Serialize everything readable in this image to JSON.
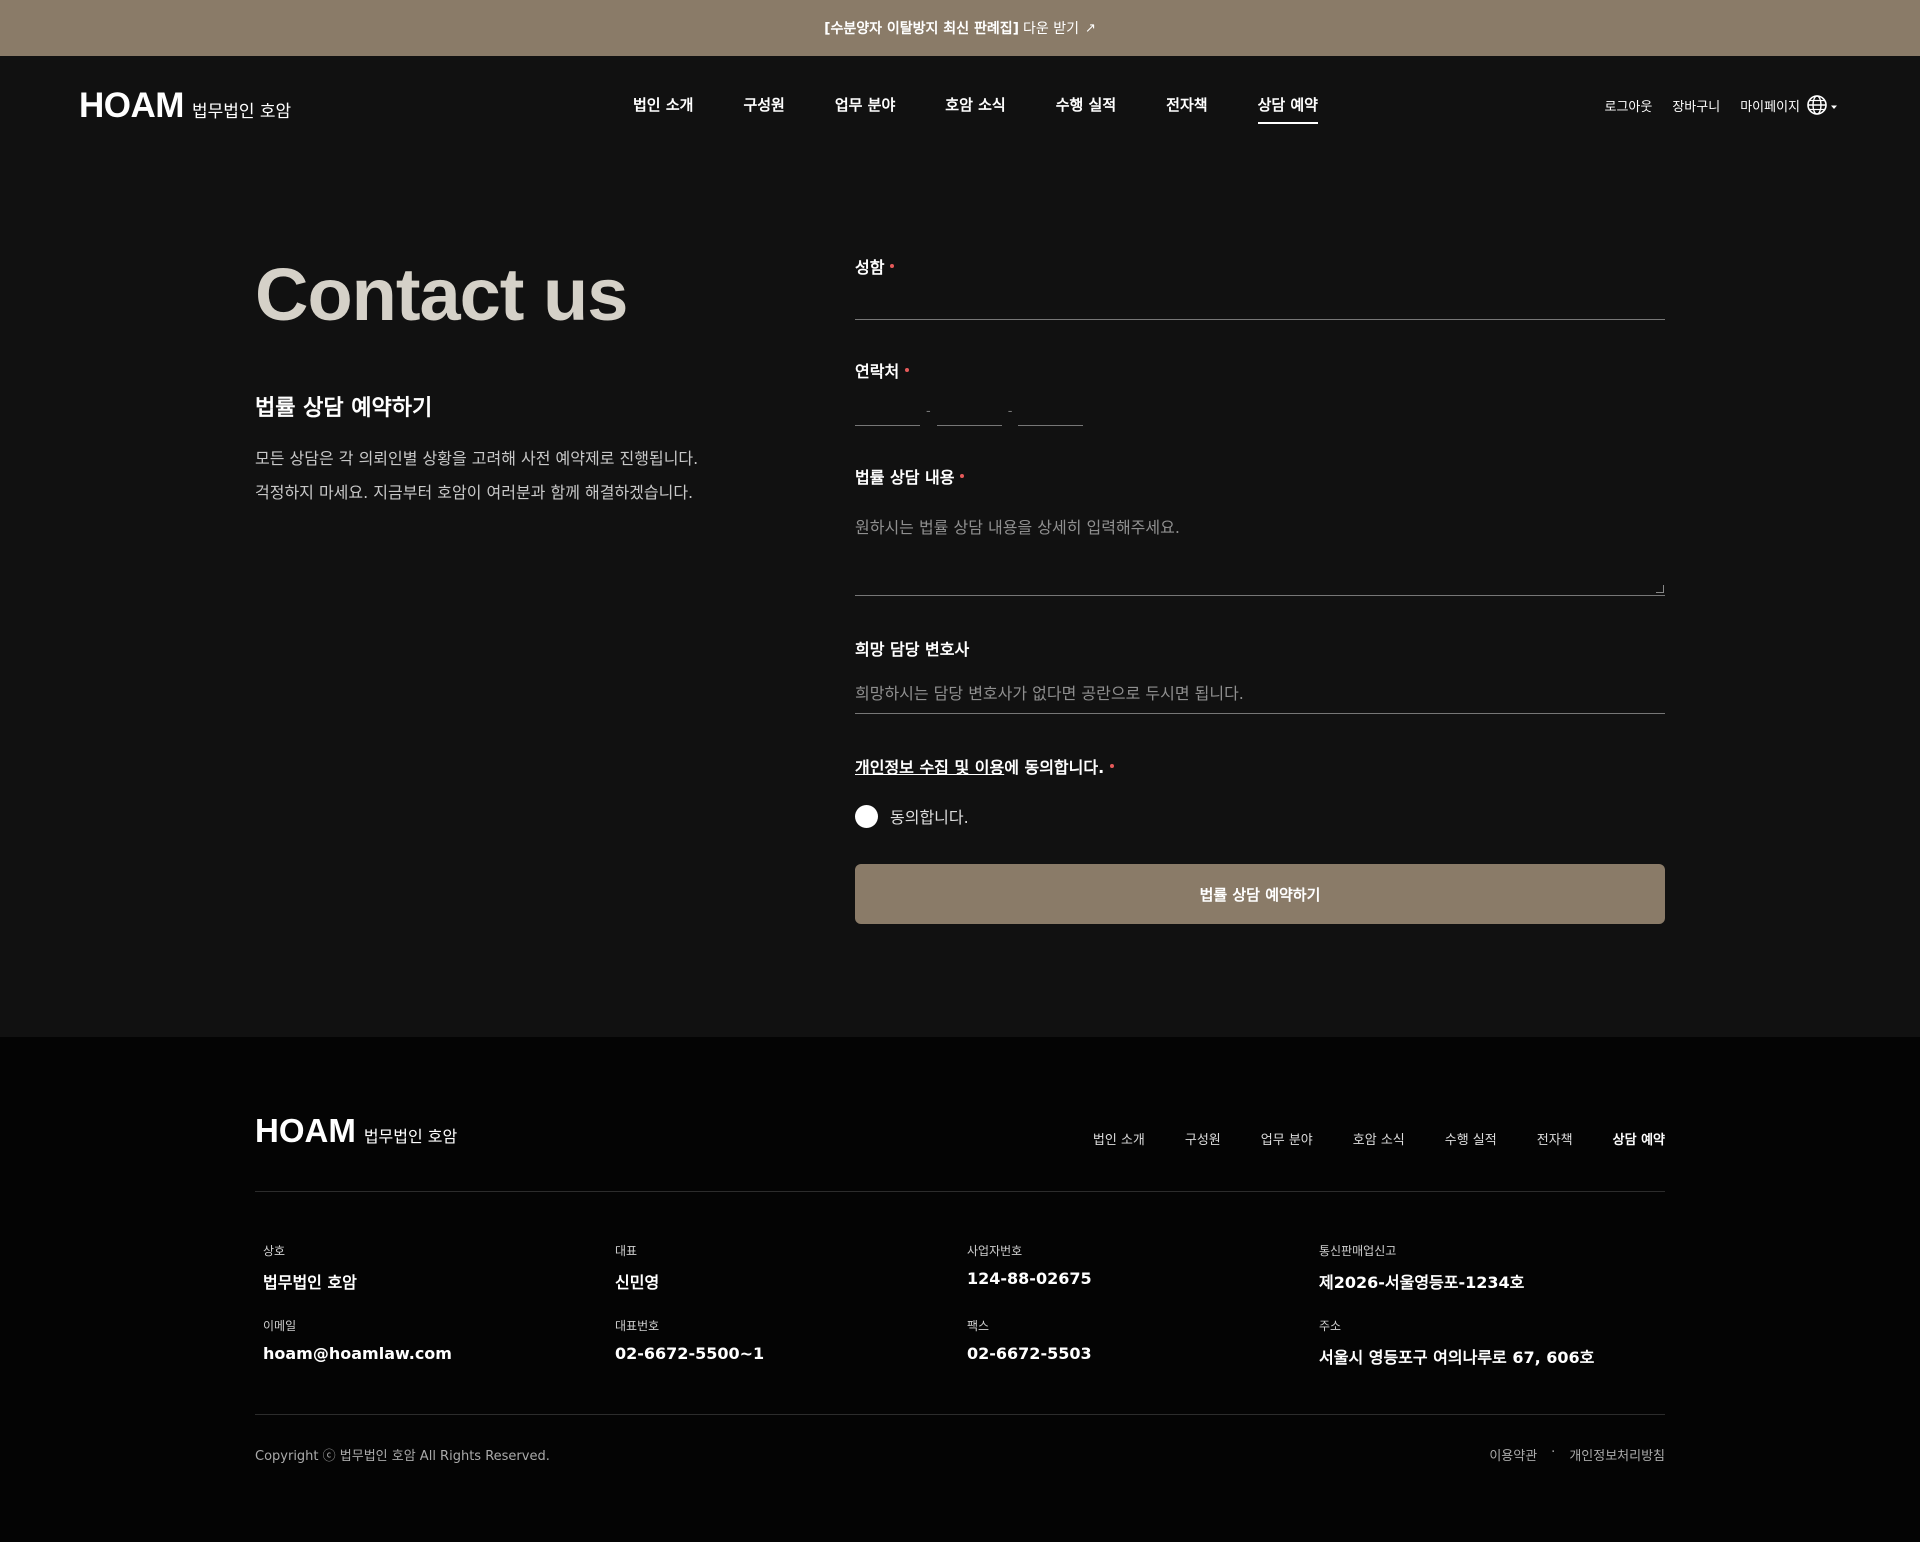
{
  "topbar": {
    "strong": "[수분양자 이탈방지 최신 판례집]",
    "rest": "다운 받기",
    "arrow": "↗"
  },
  "header": {
    "logo_main": "HOAM",
    "logo_sub": "법무법인 호암",
    "nav": [
      "법인 소개",
      "구성원",
      "업무 분야",
      "호암 소식",
      "수행 실적",
      "전자책",
      "상담 예약"
    ],
    "active_nav": "상담 예약",
    "utils": [
      "로그아웃",
      "장바구니",
      "마이페이지"
    ]
  },
  "intro": {
    "title": "Contact us",
    "subtitle": "법률 상담 예약하기",
    "desc_line1": "모든 상담은 각 의뢰인별 상황을 고려해 사전 예약제로 진행됩니다.",
    "desc_line2": "걱정하지 마세요. 지금부터 호암이 여러분과 함께 해결하겠습니다."
  },
  "form": {
    "name_label": "성함",
    "phone_label": "연락처",
    "phone_sep": "-",
    "content_label": "법률 상담 내용",
    "content_placeholder": "원하시는 법률 상담 내용을 상세히 입력해주세요.",
    "lawyer_label": "희망 담당 변호사",
    "lawyer_placeholder": "희망하시는 담당 변호사가 없다면 공란으로 두시면 됩니다.",
    "consent_link": "개인정보 수집 및 이용",
    "consent_rest": "에 동의합니다.",
    "agree_label": "동의합니다.",
    "submit_label": "법률 상담 예약하기"
  },
  "footer": {
    "logo_main": "HOAM",
    "logo_sub": "법무법인 호암",
    "nav": [
      "법인 소개",
      "구성원",
      "업무 분야",
      "호암 소식",
      "수행 실적",
      "전자책",
      "상담 예약"
    ],
    "info": [
      {
        "k": "상호",
        "v": "법무법인 호암"
      },
      {
        "k": "대표",
        "v": "신민영"
      },
      {
        "k": "사업자번호",
        "v": "124-88-02675"
      },
      {
        "k": "통신판매업신고",
        "v": "제2026-서울영등포-1234호"
      },
      {
        "k": "이메일",
        "v": "hoam@hoamlaw.com"
      },
      {
        "k": "대표번호",
        "v": "02-6672-5500~1"
      },
      {
        "k": "팩스",
        "v": "02-6672-5503"
      },
      {
        "k": "주소",
        "v": "서울시 영등포구 여의나루로 67, 606호"
      }
    ],
    "copyright": "Copyright ⓒ 법무법인 호암 All Rights Reserved.",
    "terms": "이용약관",
    "legal_sep": "·",
    "privacy": "개인정보처리방침"
  },
  "colors": {
    "accent": "#8a7b68",
    "background": "#111111",
    "footer": "#040404",
    "required_dot": "#e65a5a",
    "title": "#d5d1c8"
  },
  "icons": {
    "globe": "globe-icon",
    "language_caret": "chevron-down-icon",
    "external": "arrow-up-right-icon"
  }
}
